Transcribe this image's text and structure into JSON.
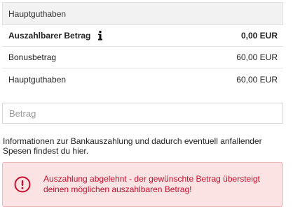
{
  "panel": {
    "header": "Hauptguthaben",
    "rows": [
      {
        "label": "Auszahlbarer Betrag",
        "value": "0,00 EUR"
      },
      {
        "label": "Bonusbetrag",
        "value": "60,00 EUR"
      },
      {
        "label": "Hauptguthaben",
        "value": "60,00 EUR"
      }
    ]
  },
  "amount_input": {
    "placeholder": "Betrag",
    "value": ""
  },
  "info_text": "Informationen zur Bankauszahlung und dadurch eventuell anfallender Spesen findest du hier.",
  "alert": {
    "message": "Auszahlung abgelehnt - der gewünschte Betrag übersteigt deinen möglichen auszahlbaren Betrag!",
    "icon": "exclamation-circle-icon"
  },
  "colors": {
    "error_text": "#c8102e",
    "error_bg": "#fbe3e4",
    "header_bg": "#f2f2f2"
  }
}
